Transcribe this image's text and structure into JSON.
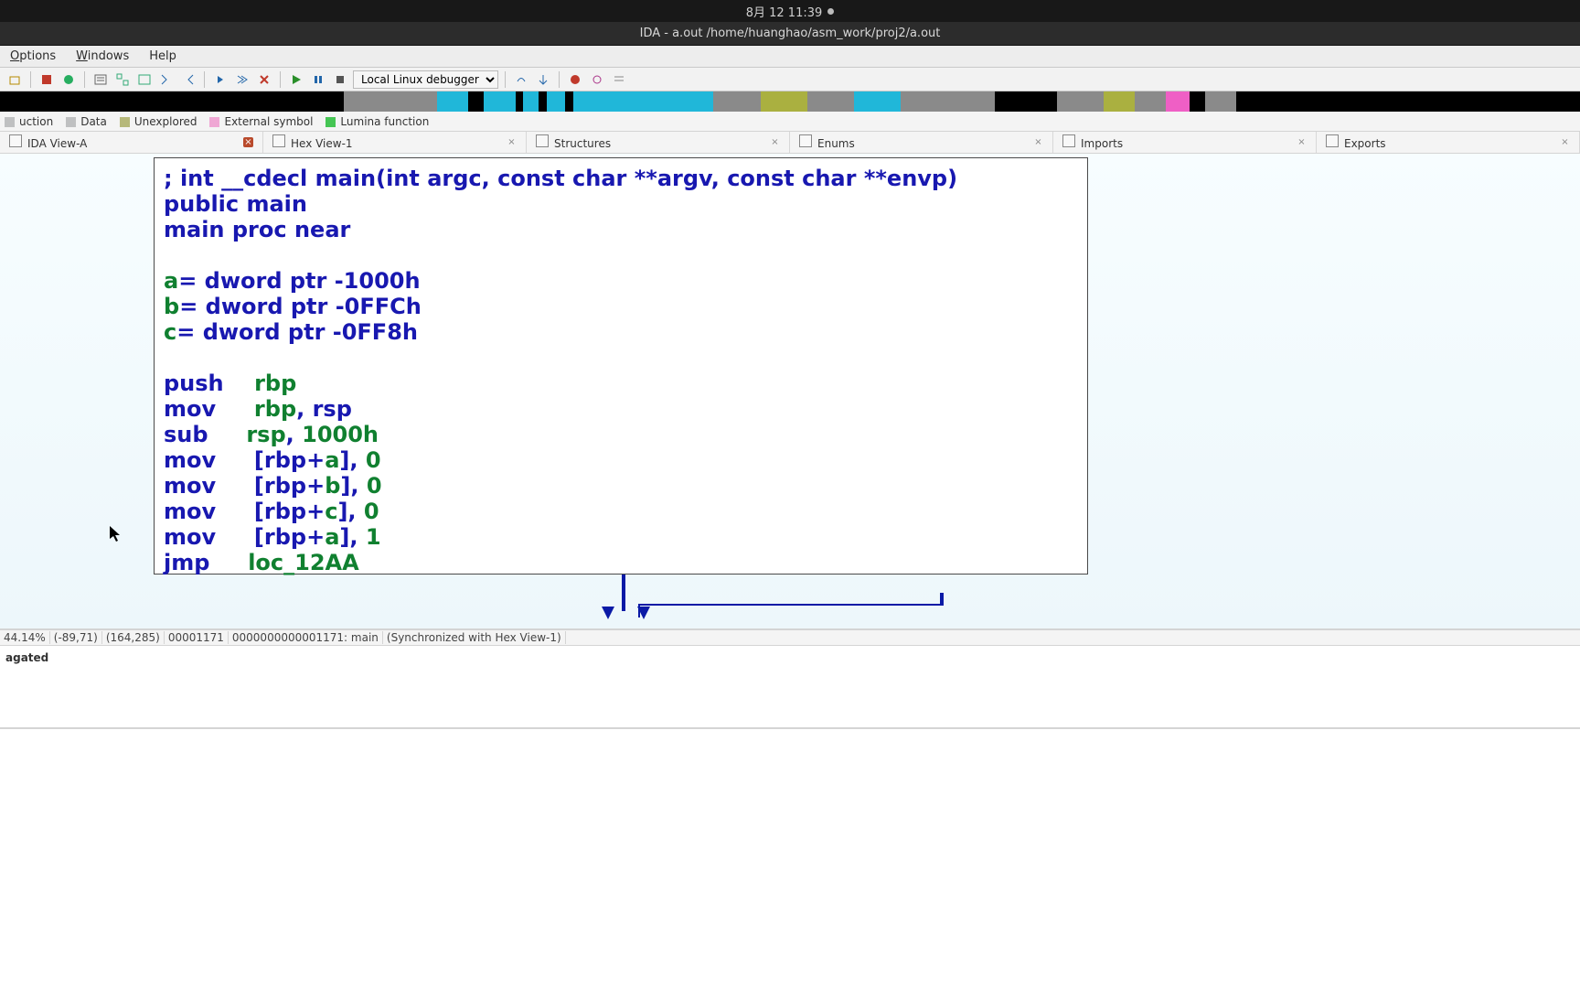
{
  "sysbar": {
    "clock": "8月 12  11:39"
  },
  "titlebar": {
    "text": "IDA - a.out /home/huanghao/asm_work/proj2/a.out"
  },
  "menubar": {
    "items": [
      "Options",
      "Windows",
      "Help"
    ]
  },
  "toolbar": {
    "debugger_selected": "Local Linux debugger"
  },
  "overview": {
    "segments": [
      {
        "c": "#000",
        "w": 22
      },
      {
        "c": "#8a8a8a",
        "w": 6
      },
      {
        "c": "#20b7d9",
        "w": 2
      },
      {
        "c": "#000",
        "w": 1
      },
      {
        "c": "#20b7d9",
        "w": 2
      },
      {
        "c": "#000",
        "w": 0.5
      },
      {
        "c": "#20b7d9",
        "w": 1
      },
      {
        "c": "#000",
        "w": 0.5
      },
      {
        "c": "#20b7d9",
        "w": 1.2
      },
      {
        "c": "#000",
        "w": 0.5
      },
      {
        "c": "#20b7d9",
        "w": 9
      },
      {
        "c": "#8a8a8a",
        "w": 3
      },
      {
        "c": "#aab040",
        "w": 3
      },
      {
        "c": "#8a8a8a",
        "w": 3
      },
      {
        "c": "#20b7d9",
        "w": 3
      },
      {
        "c": "#8a8a8a",
        "w": 6
      },
      {
        "c": "#000",
        "w": 4
      },
      {
        "c": "#8a8a8a",
        "w": 3
      },
      {
        "c": "#aab040",
        "w": 2
      },
      {
        "c": "#8a8a8a",
        "w": 2
      },
      {
        "c": "#ef5fc5",
        "w": 1.5
      },
      {
        "c": "#000",
        "w": 1
      },
      {
        "c": "#8a8a8a",
        "w": 2
      },
      {
        "c": "#000",
        "w": 22
      }
    ]
  },
  "legend": {
    "items": [
      {
        "color": "#bfc0c1",
        "label": "uction"
      },
      {
        "color": "#bfc0c1",
        "label": "Data"
      },
      {
        "color": "#b6b87a",
        "label": "Unexplored"
      },
      {
        "color": "#efa7d4",
        "label": "External symbol"
      },
      {
        "color": "#45c554",
        "label": "Lumina function"
      }
    ]
  },
  "tabs": [
    {
      "label": "IDA View-A",
      "active": true
    },
    {
      "label": "Hex View-1"
    },
    {
      "label": "Structures"
    },
    {
      "label": "Enums"
    },
    {
      "label": "Imports"
    },
    {
      "label": "Exports"
    }
  ],
  "disasm": {
    "signature": "; int __cdecl main(int argc, const char **argv, const char **envp)",
    "pub": "public main",
    "proc": "main proc near",
    "vars": [
      {
        "name": "a",
        "def": "= dword ptr -1000h"
      },
      {
        "name": "b",
        "def": "= dword ptr -0FFCh"
      },
      {
        "name": "c",
        "def": "= dword ptr -0FF8h"
      }
    ],
    "instr": [
      {
        "op": "push",
        "args_pre": "",
        "id": "rbp",
        "args_post": ""
      },
      {
        "op": "mov",
        "args_pre": "",
        "id": "rbp",
        "args_post": ", rsp"
      },
      {
        "op": "sub",
        "args_pre": "",
        "id": "rsp",
        "args_post": ", ",
        "num": "1000h"
      },
      {
        "op": "mov",
        "args_pre": "[rbp+",
        "id": "a",
        "args_post": "], ",
        "num": "0"
      },
      {
        "op": "mov",
        "args_pre": "[rbp+",
        "id": "b",
        "args_post": "], ",
        "num": "0"
      },
      {
        "op": "mov",
        "args_pre": "[rbp+",
        "id": "c",
        "args_post": "], ",
        "num": "0"
      },
      {
        "op": "mov",
        "args_pre": "[rbp+",
        "id": "a",
        "args_post": "], ",
        "num": "1"
      },
      {
        "op": "jmp",
        "args_pre": "",
        "id": "loc_12AA",
        "args_post": ""
      }
    ]
  },
  "status": {
    "zoom": "44.14%",
    "mouse": "(-89,71)",
    "cursor": "(164,285)",
    "addr": "00001171",
    "full": "0000000000001171: main",
    "sync": "(Synchronized with Hex View-1)"
  },
  "output": {
    "line": "agated"
  }
}
